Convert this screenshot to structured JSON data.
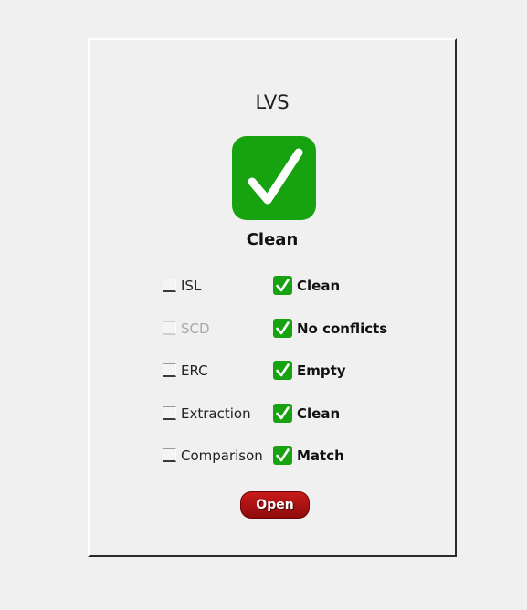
{
  "panel": {
    "title": "LVS",
    "status": "Clean",
    "status_icon": "checkmark-icon",
    "accent_color": "#17a30f"
  },
  "checks": [
    {
      "label": "ISL",
      "result": "Clean",
      "enabled": true,
      "checked": false
    },
    {
      "label": "SCD",
      "result": "No conflicts",
      "enabled": false,
      "checked": false
    },
    {
      "label": "ERC",
      "result": "Empty",
      "enabled": true,
      "checked": false
    },
    {
      "label": "Extraction",
      "result": "Clean",
      "enabled": true,
      "checked": false
    },
    {
      "label": "Comparison",
      "result": "Match",
      "enabled": true,
      "checked": false
    }
  ],
  "open_button": {
    "label": "Open",
    "color": "#b01010"
  }
}
